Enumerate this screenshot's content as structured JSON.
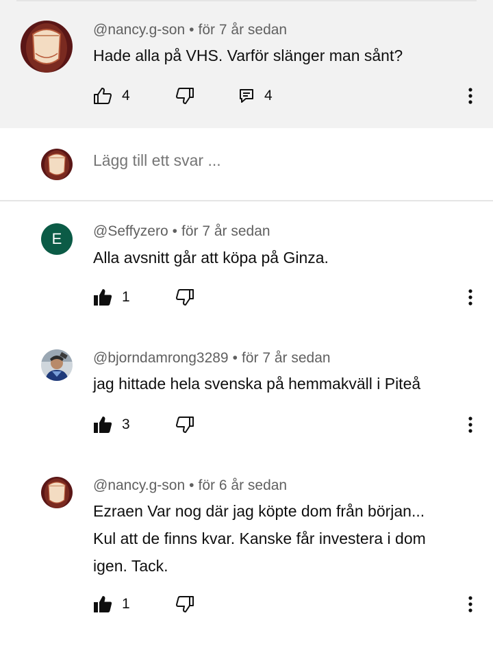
{
  "parent_comment": {
    "author": "@nancy.g-son",
    "time": "för 7 år sedan",
    "text": "Hade alla på VHS. Varför slänger man sånt?",
    "likes": "4",
    "replies": "4"
  },
  "reply_box": {
    "placeholder": "Lägg till ett svar ..."
  },
  "replies": [
    {
      "author": "@Seffyzero",
      "avatar_initial": "E",
      "time": "för 7 år sedan",
      "text": "Alla avsnitt går att köpa på Ginza.",
      "likes": "1"
    },
    {
      "author": "@bjorndamrong3289",
      "time": "för 7 år sedan",
      "text": "jag hittade hela svenska på hemmakväll i Piteå",
      "likes": "3"
    },
    {
      "author": "@nancy.g-son",
      "time": "för 6 år sedan",
      "text_lines": [
        "Ezraen Var nog där jag köpte dom från början...",
        "Kul att de finns kvar. Kanske får investera i dom",
        "igen. Tack."
      ],
      "likes": "1"
    }
  ],
  "meta_separator": "•",
  "colors": {
    "parent_bg": "#f2f2f2",
    "secondary_text": "#606060",
    "placeholder": "#909090",
    "avatar_green": "#0b5b46"
  },
  "icons": [
    "thumb-up-outline-icon",
    "thumb-up-filled-icon",
    "thumb-down-outline-icon",
    "reply-comment-icon",
    "more-vertical-icon"
  ]
}
